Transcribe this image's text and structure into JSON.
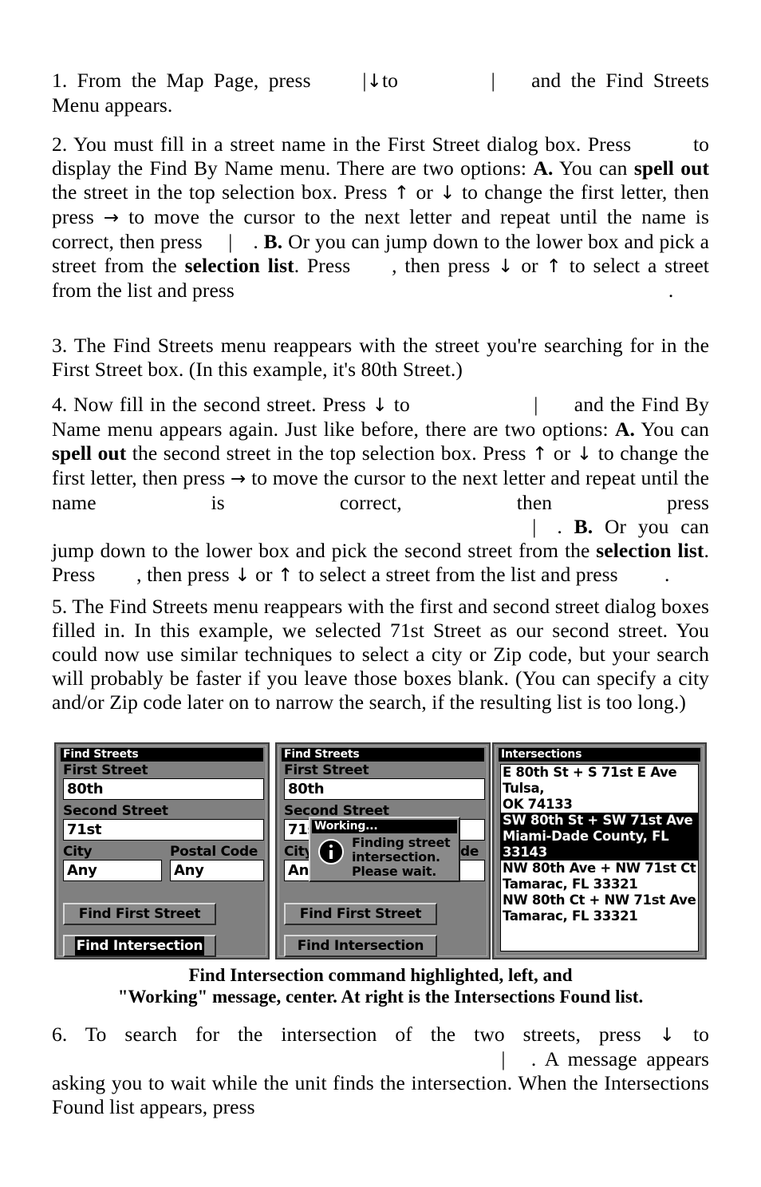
{
  "document": {
    "type": "manual-page",
    "paragraphs": [
      {
        "id": "step-1",
        "number": "1.",
        "segments": [
          {
            "text": "1. From the Map Page, press "
          },
          {
            "text": "        ",
            "kind": "gap"
          },
          {
            "text": "|",
            "kind": "bar"
          },
          {
            "text": "↓",
            "kind": "arrow"
          },
          {
            "text": " to "
          },
          {
            "text": "              ",
            "kind": "gap"
          },
          {
            "text": "|",
            "kind": "bar"
          },
          {
            "text": "      ",
            "kind": "gap"
          },
          {
            "text": " and the Find Streets Menu appears."
          }
        ],
        "plain": "1. From the Map Page, press | ↓ to | and the Find Streets Menu appears."
      },
      {
        "id": "step-2",
        "number": "2.",
        "plain": "2. You must fill in a street name in the First Street dialog box. Press to display the Find By Name menu. There are two options: A. You can spell out the street in the top selection box. Press ↑ or ↓ to change the first letter, then press → to move the cursor to the next letter and repeat until the name is correct, then press | . B. Or you can jump down to the lower box and pick a street from the selection list. Press , then press ↓ or ↑ to select a street from the list and press ."
      },
      {
        "id": "step-3",
        "number": "3.",
        "plain": "3. The Find Streets menu reappears with the street you're searching for in the First Street box. (In this example, it's 80th Street.)"
      },
      {
        "id": "step-4",
        "number": "4.",
        "plain": "4. Now fill in the second street. Press ↓ to | and the Find By Name menu appears again. Just like before, there are two options: A. You can spell out the second street in the top selection box. Press ↑ or ↓ to change the first letter, then press → to move the cursor to the next letter and repeat until the name is correct, then press | . B. Or you can jump down to the lower box and pick the second street from the selection list. Press , then press ↓ or ↑ to select a street from the list and press ."
      },
      {
        "id": "step-5",
        "number": "5.",
        "plain": "5. The Find Streets menu reappears with the first and second street dialog boxes filled in. In this example, we selected 71st Street as our second street. You could now use similar techniques to select a city or Zip code, but your search will probably be faster if you leave those boxes blank. (You can specify a city and/or Zip code later on to narrow the search, if the resulting list is too long.)"
      },
      {
        "id": "step-6",
        "number": "6.",
        "plain": "6. To search for the intersection of the two streets, press ↓ to | . A message appears asking you to wait while the unit finds the intersection. When the Intersections Found list appears, press"
      }
    ],
    "text": {
      "p1_a": "1. From the Map Page, press",
      "p1_to": "to",
      "p1_b": "and the Find Streets Menu appears.",
      "p2_a": "2. You must fill in a street name in the First Street dialog box. Press",
      "p2_b": "to display the Find By Name menu. There are two options:",
      "p2_A": "A.",
      "p2_c": "You can",
      "p2_spellout": "spell out",
      "p2_d": "the street in the top selection box. Press",
      "p2_or": "or",
      "p2_e": "to change the first letter, then press",
      "p2_f": "to move the cursor to the next letter and repeat until the name is correct, then press",
      "p2_B": "B.",
      "p2_g": "Or you can jump down to the lower box and pick a street from the",
      "p2_sellist": "selection list",
      "p2_h": "Press",
      "p2_i": ", then press",
      "p2_j": "to select a street from the list and press",
      "p3": "3. The Find Streets menu reappears with the street you're searching for in the First Street box. (In this example, it's 80th Street.)",
      "p4_a": "4. Now fill in the second street. Press",
      "p4_b": "and the Find By Name menu appears again. Just like before, there are two options:",
      "p4_A": "A.",
      "p4_c": "You can",
      "p4_spellout": "spell out",
      "p4_d": "the second street in the top selection box. Press",
      "p4_e": "to change the first letter, then press",
      "p4_f": "to move the cursor to the next letter and repeat until the name is correct, then press",
      "p4_B": "B.",
      "p4_g": "Or you can jump down to the lower box and pick the second street from the",
      "p4_sellist": "selection list",
      "p4_h": "Press",
      "p4_i": ", then press",
      "p4_j": "to select a street from the list and press",
      "p5": "5. The Find Streets menu reappears with the first and second street dialog boxes filled in. In this example, we selected 71st Street as our second street. You could now use similar techniques to select a city or Zip code, but your search will probably be faster if you leave those boxes blank. (You can specify a city and/or Zip code later on to narrow the search, if the resulting list is too long.)",
      "p6_a": "6. To search for the intersection of the two streets, press",
      "p6_b": ". A message appears asking you to wait while the unit finds the intersection. When the Intersections Found list appears, press",
      "arrow_down": "↓",
      "arrow_up": "↑",
      "arrow_right": "→",
      "bar": "|",
      "period": ".",
      "to": "to",
      "or": "or"
    },
    "caption": {
      "line1": "Find Intersection command highlighted, left, and",
      "line2": "\"Working\" message, center. At right is the Intersections Found list."
    }
  },
  "screens": [
    {
      "id": "find-streets-left",
      "title": "Find Streets",
      "fields": [
        {
          "label": "First Street",
          "value": "80th"
        },
        {
          "label": "Second Street",
          "value": "71st"
        },
        {
          "label": "City",
          "value": "Any"
        },
        {
          "label": "Postal Code",
          "value": "Any"
        }
      ],
      "buttons": [
        {
          "label": "Find First Street",
          "selected": false
        },
        {
          "label": "Find Intersection",
          "selected": true
        }
      ]
    },
    {
      "id": "find-streets-center",
      "title": "Find Streets",
      "fields": [
        {
          "label": "First Street",
          "value": "80th"
        },
        {
          "label": "Second Street",
          "value": "71st"
        },
        {
          "label": "City",
          "value": "Any"
        },
        {
          "label": "Postal Code",
          "value": "Any"
        }
      ],
      "buttons": [
        {
          "label": "Find First Street",
          "selected": false
        },
        {
          "label": "Find Intersection",
          "selected": false
        }
      ],
      "dialog": {
        "title": "Working...",
        "message": "Finding street intersection.  Please wait.",
        "icon": "info-icon"
      }
    },
    {
      "id": "intersections-right",
      "title": "Intersections",
      "items": [
        {
          "text": "E 80th St + S 71st E Ave Tulsa,\nOK  74133",
          "highlighted": false
        },
        {
          "text": "SW 80th St + SW 71st Ave\nMiami-Dade County, FL  33143",
          "highlighted": true
        },
        {
          "text": "NW 80th Ave + NW 71st Ct\nTamarac, FL  33321",
          "highlighted": false
        },
        {
          "text": "NW 80th Ct + NW 71st Ave\nTamarac, FL  33321",
          "highlighted": false
        }
      ]
    }
  ],
  "colors": {
    "page_background": "#ffffff",
    "text": "#000000",
    "screen_background": "#808080",
    "screen_border": "#3b3b3b",
    "titlebar_background": "#000000",
    "titlebar_text": "#ffffff",
    "field_background": "#ffffff",
    "button_face": "#8a8a8a",
    "highlight_background": "#000000",
    "highlight_text": "#ffffff"
  }
}
